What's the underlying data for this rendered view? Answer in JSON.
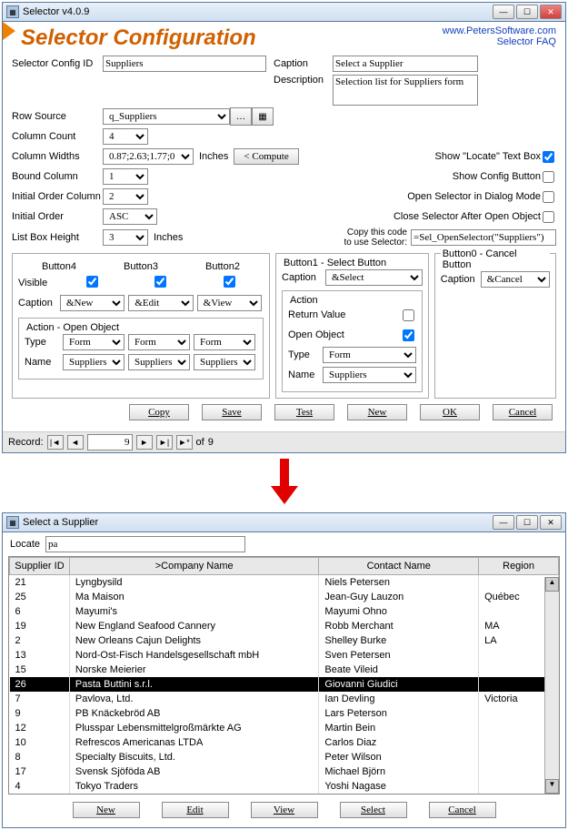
{
  "config_window": {
    "title": "Selector v4.0.9",
    "big_title": "Selector Configuration",
    "link1": "www.PetersSoftware.com",
    "link2": "Selector FAQ",
    "labels": {
      "config_id": "Selector Config ID",
      "caption": "Caption",
      "description": "Description",
      "row_source": "Row Source",
      "column_count": "Column Count",
      "column_widths": "Column Widths",
      "bound_column": "Bound Column",
      "initial_order_col": "Initial Order Column",
      "initial_order": "Initial Order",
      "list_box_height": "List Box Height",
      "inches": "Inches",
      "compute": "< Compute",
      "show_locate": "Show \"Locate\" Text Box",
      "show_config": "Show Config Button",
      "open_dialog": "Open Selector in Dialog Mode",
      "close_after": "Close Selector After Open Object",
      "copy_code": "Copy this code\nto use Selector:",
      "visible": "Visible",
      "caption_s": "Caption",
      "action_open": "Action - Open Object",
      "type": "Type",
      "name": "Name",
      "button4": "Button4",
      "button3": "Button3",
      "button2": "Button2",
      "button1": "Button1 - Select Button",
      "button0": "Button0 - Cancel Button",
      "action": "Action",
      "return_value": "Return Value",
      "open_object": "Open Object",
      "record": "Record:",
      "of": "of"
    },
    "values": {
      "config_id": "Suppliers",
      "caption": "Select a Supplier",
      "description": "Selection list for Suppliers form",
      "row_source": "q_Suppliers",
      "column_count": "4",
      "column_widths": "0.87;2.63;1.77;0",
      "bound_column": "1",
      "initial_order_col": "2",
      "initial_order": "ASC",
      "list_box_height": "3",
      "copy_code": "=Sel_OpenSelector(\"Suppliers\")",
      "btn4_caption": "&New",
      "btn3_caption": "&Edit",
      "btn2_caption": "&View",
      "btn1_caption": "&Select",
      "btn0_caption": "&Cancel",
      "type4": "Form",
      "type3": "Form",
      "type2": "Form",
      "type1": "Form",
      "name4": "Suppliers",
      "name3": "Suppliers",
      "name2": "Suppliers",
      "name1": "Suppliers",
      "record_num": "9",
      "record_total": "9"
    },
    "show_locate_chk": true,
    "show_config_chk": false,
    "open_dialog_chk": false,
    "close_after_chk": false,
    "visible4": true,
    "visible3": true,
    "visible2": true,
    "return_value_chk": false,
    "open_object_chk": true,
    "bottom_buttons": {
      "copy": "Copy",
      "save": "Save",
      "test": "Test",
      "new": "New",
      "ok": "OK",
      "cancel": "Cancel"
    }
  },
  "select_window": {
    "title": "Select a Supplier",
    "locate_label": "Locate",
    "locate_value": "pa",
    "columns": [
      "Supplier ID",
      ">Company Name",
      "Contact Name",
      "Region"
    ],
    "rows": [
      {
        "id": "21",
        "company": "Lyngbysild",
        "contact": "Niels Petersen",
        "region": ""
      },
      {
        "id": "25",
        "company": "Ma Maison",
        "contact": "Jean-Guy Lauzon",
        "region": "Québec"
      },
      {
        "id": "6",
        "company": "Mayumi's",
        "contact": "Mayumi Ohno",
        "region": ""
      },
      {
        "id": "19",
        "company": "New England Seafood Cannery",
        "contact": "Robb Merchant",
        "region": "MA"
      },
      {
        "id": "2",
        "company": "New Orleans Cajun Delights",
        "contact": "Shelley Burke",
        "region": "LA"
      },
      {
        "id": "13",
        "company": "Nord-Ost-Fisch Handelsgesellschaft mbH",
        "contact": "Sven Petersen",
        "region": ""
      },
      {
        "id": "15",
        "company": "Norske Meierier",
        "contact": "Beate Vileid",
        "region": ""
      },
      {
        "id": "26",
        "company": "Pasta Buttini s.r.l.",
        "contact": "Giovanni Giudici",
        "region": "",
        "selected": true
      },
      {
        "id": "7",
        "company": "Pavlova, Ltd.",
        "contact": "Ian Devling",
        "region": "Victoria"
      },
      {
        "id": "9",
        "company": "PB Knäckebröd AB",
        "contact": "Lars Peterson",
        "region": ""
      },
      {
        "id": "12",
        "company": "Plusspar Lebensmittelgroßmärkte AG",
        "contact": "Martin Bein",
        "region": ""
      },
      {
        "id": "10",
        "company": "Refrescos Americanas LTDA",
        "contact": "Carlos Diaz",
        "region": ""
      },
      {
        "id": "8",
        "company": "Specialty Biscuits, Ltd.",
        "contact": "Peter Wilson",
        "region": ""
      },
      {
        "id": "17",
        "company": "Svensk Sjöföda AB",
        "contact": "Michael Björn",
        "region": ""
      },
      {
        "id": "4",
        "company": "Tokyo Traders",
        "contact": "Yoshi Nagase",
        "region": ""
      }
    ],
    "buttons": {
      "new": "New",
      "edit": "Edit",
      "view": "View",
      "select": "Select",
      "cancel": "Cancel"
    }
  }
}
